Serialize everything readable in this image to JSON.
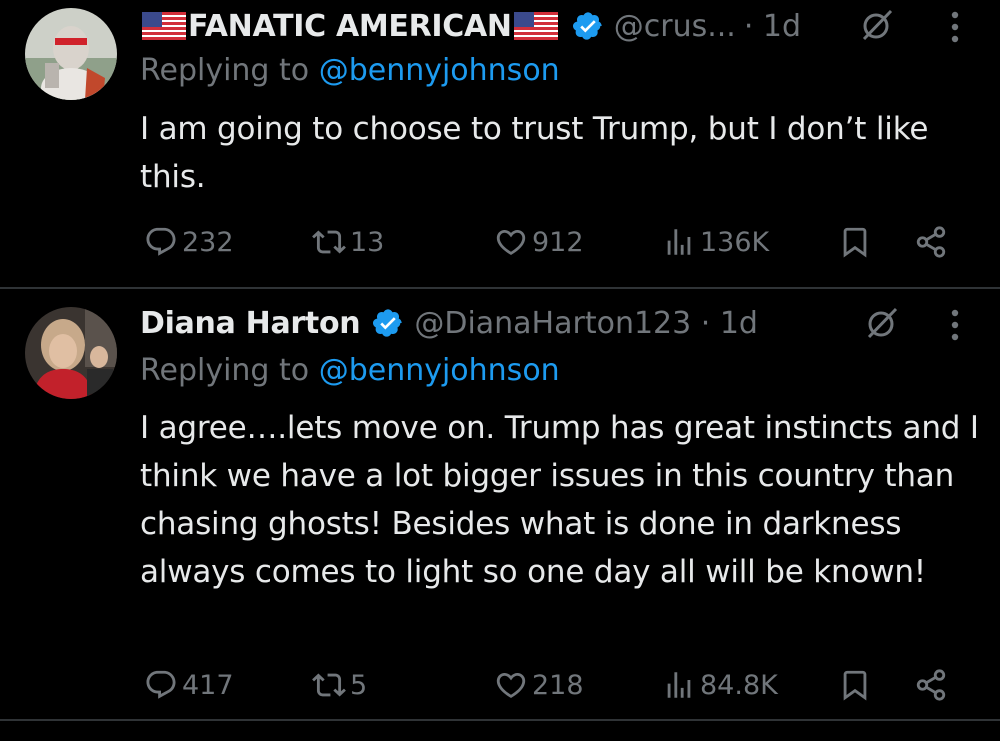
{
  "tweets": [
    {
      "display_name": "FANATIC AMERICAN",
      "handle": "@crus...",
      "time": "· 1d",
      "replying_prefix": "Replying to",
      "replying_to": "@bennyjohnson",
      "text": "I am going to choose to trust Trump, but I don’t like this.",
      "stats": {
        "replies": "232",
        "reposts": "13",
        "likes": "912",
        "views": "136K"
      }
    },
    {
      "display_name": "Diana Harton",
      "handle": "@DianaHarton123 · 1d",
      "replying_prefix": "Replying to",
      "replying_to": "@bennyjohnson",
      "text": "I agree….lets move on.  Trump has great instincts and I think we have a lot bigger issues in this country than chasing ghosts!  Besides what is done in darkness always comes to light so one day all will be known!",
      "stats": {
        "replies": "417",
        "reposts": "5",
        "likes": "218",
        "views": "84.8K"
      }
    }
  ],
  "colors": {
    "background": "#000000",
    "text": "#e7e9ea",
    "muted": "#71767b",
    "link": "#1d9bf0",
    "verified": "#1d9bf0"
  }
}
